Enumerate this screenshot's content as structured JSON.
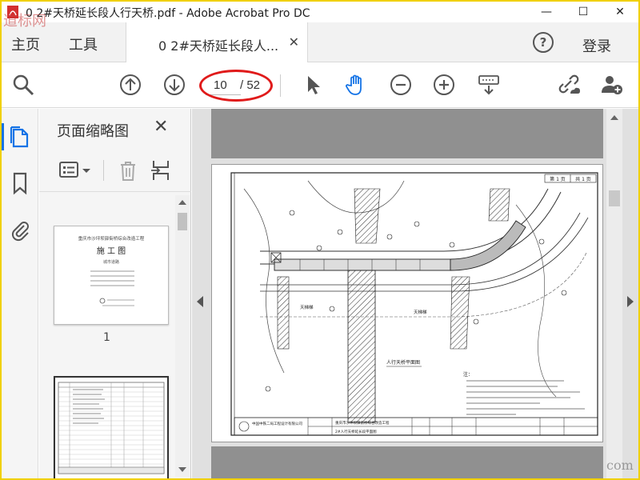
{
  "window": {
    "title": "0 2#天桥延长段人行天桥.pdf - Adobe Acrobat Pro DC",
    "minimize": "—",
    "maximize": "☐",
    "close": "✕"
  },
  "tabs": {
    "home": "主页",
    "tools": "工具",
    "document_tab": "0 2#天桥延长段人...",
    "document_tab_close": "✕",
    "help": "?",
    "login": "登录"
  },
  "toolbar": {
    "page_current": "10",
    "page_total": "/ 52",
    "highlight_color": "#e01a1a"
  },
  "panel": {
    "title": "页面缩略图",
    "close": "✕",
    "thumbnails": [
      {
        "number": "1",
        "line1": "重庆市沙坪坝驿街桥综合改造工程",
        "line2": "施 工 图",
        "line3": "城市道路"
      }
    ]
  },
  "drawing": {
    "sheet_no": "第 1 页",
    "sheet_total": "共 1 页",
    "label_stair_left": "天梯梯",
    "label_stair_right": "天梯梯",
    "plan_title": "人行天桥平面图",
    "notes_title": "注：",
    "company": "中国中铁二局工程设计有限公司",
    "project": "重庆市沙坪坝驿街桥综合改造工程",
    "drawing_name": "2#人行天桥延长段平面图"
  },
  "watermark": {
    "logo": "道标网",
    "com": "com"
  },
  "colors": {
    "accent": "#1473e6",
    "frame": "#f0d000"
  }
}
